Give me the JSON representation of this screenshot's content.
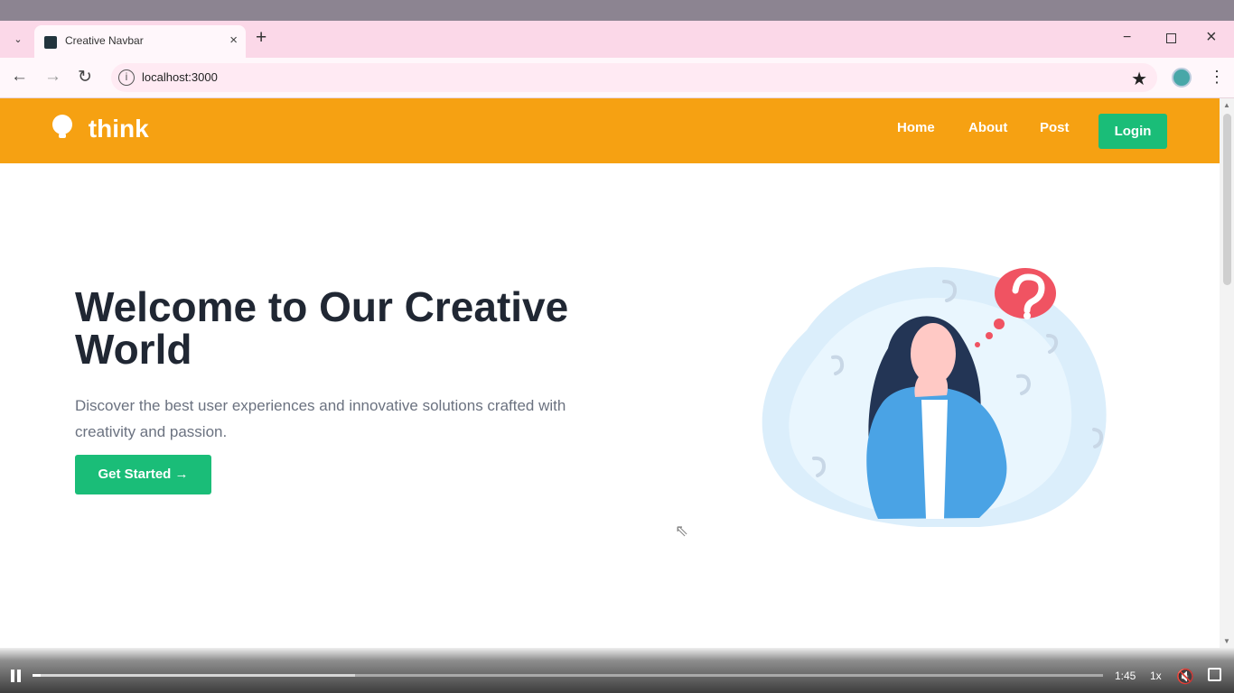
{
  "browser": {
    "tab": {
      "title": "Creative Navbar"
    },
    "address": "localhost:3000",
    "icons": {
      "tab_dropdown": "chevron-down-icon",
      "new_tab": "plus-icon",
      "close": "close-icon",
      "back": "arrow-left-icon",
      "forward": "arrow-right-icon",
      "reload": "reload-icon",
      "info": "info-icon",
      "bookmark": "star-icon",
      "menu": "vertical-dots-icon"
    }
  },
  "page": {
    "brand": "think",
    "nav": [
      {
        "label": "Home"
      },
      {
        "label": "About"
      },
      {
        "label": "Post"
      }
    ],
    "login": "Login",
    "hero": {
      "title": "Welcome to Our Creative World",
      "subtitle": "Discover the best user experiences and innovative solutions crafted with creativity and passion.",
      "button": "Get Started →"
    },
    "colors": {
      "navbar": "#f6a112",
      "accent": "#1abd78",
      "heading": "#202733",
      "text": "#6b7280"
    }
  },
  "player": {
    "time": "1:45",
    "speed": "1x",
    "progress": 0.0076,
    "buffered": 0.3012
  }
}
